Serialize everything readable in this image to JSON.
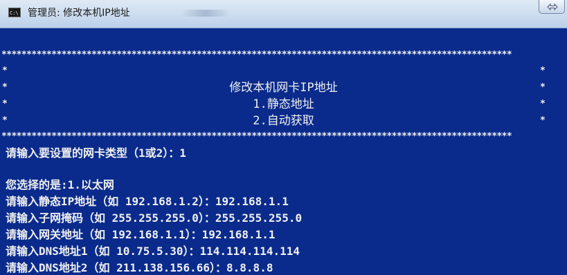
{
  "window": {
    "icon_label": "C:\\",
    "title": "管理员: 修改本机IP地址"
  },
  "banner": {
    "star_line": "******************************************************************************************************",
    "edge_marker": "*",
    "title": "修改本机网卡IP地址",
    "option1": "1.静态地址",
    "option2": "2.自动获取"
  },
  "console_lines": {
    "prompt_type": "请输入要设置的网卡类型（1或2）：1",
    "selected": "您选择的是:1.以太网",
    "ip": "请输入静态IP地址（如 192.168.1.2）：192.168.1.1",
    "mask": "请输入子网掩码（如 255.255.255.0）：255.255.255.0",
    "gateway": "请输入网关地址（如 192.168.1.1）：192.168.1.1",
    "dns1": "请输入DNS地址1（如 10.75.5.30）：114.114.114.114",
    "dns2": "请输入DNS地址2（如 211.138.156.66）：8.8.8.8"
  },
  "colors": {
    "console_bg": "#0a2b8c",
    "console_fg": "#f0f0f0",
    "titlebar": "#cfdff0"
  },
  "icons": {
    "app": "cmd-icon",
    "restore": "restore-icon"
  }
}
